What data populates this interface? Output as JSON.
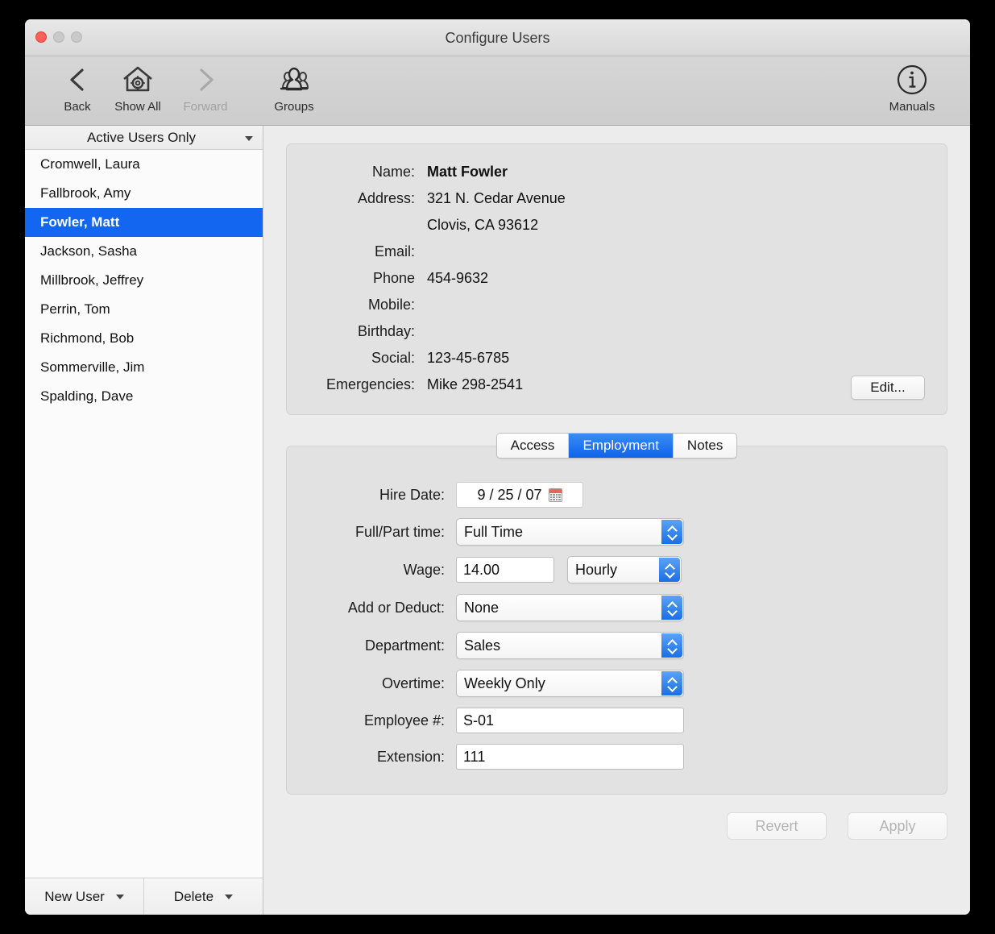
{
  "window": {
    "title": "Configure Users",
    "traffic_lights": [
      "close",
      "minimize",
      "zoom"
    ]
  },
  "toolbar": {
    "items": [
      {
        "label": "Back",
        "icon": "chevron-left-icon",
        "enabled": true
      },
      {
        "label": "Show All",
        "icon": "house-gear-icon",
        "enabled": true
      },
      {
        "label": "Forward",
        "icon": "chevron-right-icon",
        "enabled": false
      },
      {
        "label": "Groups",
        "icon": "groups-people-icon",
        "enabled": true
      },
      {
        "label": "Manuals",
        "icon": "info-circle-icon",
        "enabled": true
      }
    ]
  },
  "sidebar": {
    "filter": {
      "selected": "Active Users Only",
      "icon": "chevron-down-icon"
    },
    "users": [
      {
        "name": "Cromwell, Laura",
        "selected": false
      },
      {
        "name": "Fallbrook, Amy",
        "selected": false
      },
      {
        "name": "Fowler, Matt",
        "selected": true
      },
      {
        "name": "Jackson, Sasha",
        "selected": false
      },
      {
        "name": "Millbrook, Jeffrey",
        "selected": false
      },
      {
        "name": "Perrin, Tom",
        "selected": false
      },
      {
        "name": "Richmond, Bob",
        "selected": false
      },
      {
        "name": "Sommerville, Jim",
        "selected": false
      },
      {
        "name": "Spalding, Dave",
        "selected": false
      }
    ],
    "footer": {
      "new_user": "New User",
      "delete": "Delete"
    }
  },
  "info_card": {
    "rows": [
      {
        "label": "Name:",
        "value": "Matt Fowler",
        "bold": true
      },
      {
        "label": "Address:",
        "value": "321 N. Cedar Avenue",
        "value2": "Clovis, CA 93612",
        "bold": false
      },
      {
        "label": "Email:",
        "value": "",
        "bold": false
      },
      {
        "label": "Phone",
        "value": "454-9632",
        "bold": false
      },
      {
        "label": "Mobile:",
        "value": "",
        "bold": false
      },
      {
        "label": "Birthday:",
        "value": "",
        "bold": false
      },
      {
        "label": "Social:",
        "value": "123-45-6785",
        "bold": false
      },
      {
        "label": "Emergencies:",
        "value": "Mike  298-2541",
        "bold": false
      }
    ],
    "edit_button": "Edit..."
  },
  "tabs": [
    {
      "label": "Access",
      "active": false
    },
    {
      "label": "Employment",
      "active": true
    },
    {
      "label": "Notes",
      "active": false
    }
  ],
  "employment": {
    "hire_date": {
      "label": "Hire Date:",
      "value": "9 / 25 / 07",
      "icon": "calendar-icon"
    },
    "full_part_time": {
      "label": "Full/Part time:",
      "value": "Full Time"
    },
    "wage": {
      "label": "Wage:",
      "value": "14.00",
      "unit": "Hourly"
    },
    "add_or_deduct": {
      "label": "Add or Deduct:",
      "value": "None"
    },
    "department": {
      "label": "Department:",
      "value": "Sales"
    },
    "overtime": {
      "label": "Overtime:",
      "value": "Weekly Only"
    },
    "employee_number": {
      "label": "Employee #:",
      "value": "S-01"
    },
    "extension": {
      "label": "Extension:",
      "value": "111"
    }
  },
  "actions": {
    "revert": "Revert",
    "apply": "Apply"
  },
  "colors": {
    "selection_blue": "#1266ef",
    "tab_active_blue": "#0f63e8",
    "stepper_blue": "#1a6fe8",
    "calendar_red": "#e8655c",
    "window_bg": "#ececec",
    "panel_bg": "#e2e2e2"
  }
}
